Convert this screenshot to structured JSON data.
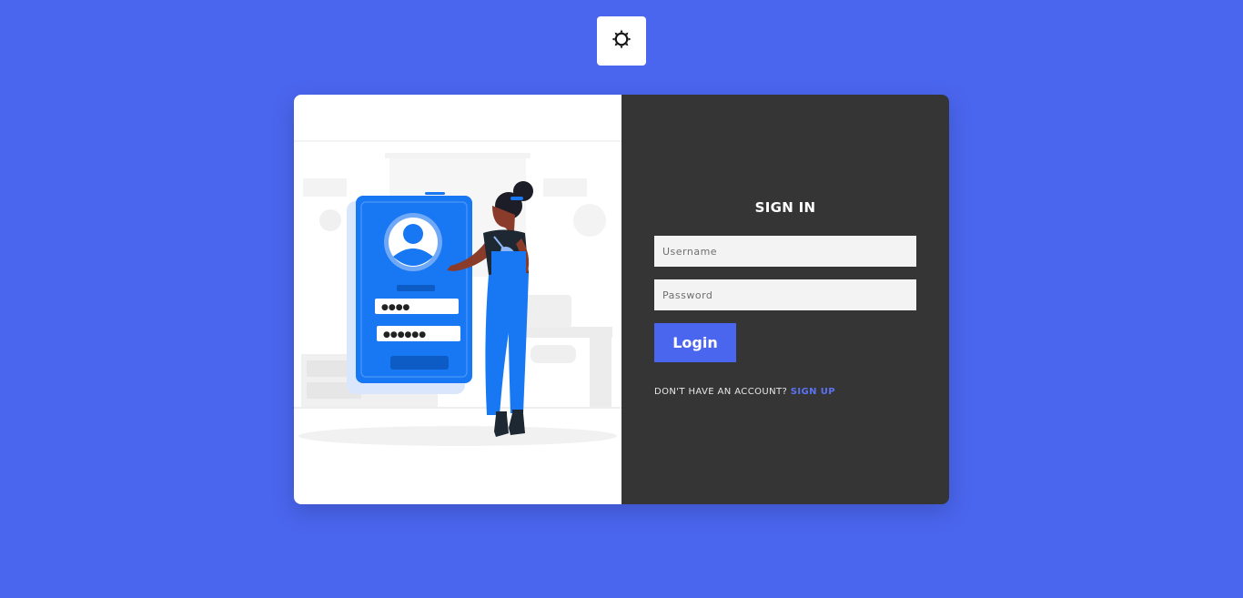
{
  "theme_toggle": {
    "icon": "sun-icon"
  },
  "illustration": {
    "description_icon": "person-login-illustration",
    "password_dots_1": "●●●●",
    "password_dots_2": "●●●●●●"
  },
  "signin": {
    "title": "SIGN IN",
    "username_placeholder": "Username",
    "password_placeholder": "Password",
    "login_label": "Login",
    "no_account_text": "DON'T HAVE AN ACCOUNT?",
    "signup_label": "SIGN UP"
  },
  "colors": {
    "background": "#4b66ee",
    "panel_dark": "#353535",
    "accent": "#4b66ee",
    "link": "#5b73f2",
    "phone_blue": "#1877f2"
  }
}
